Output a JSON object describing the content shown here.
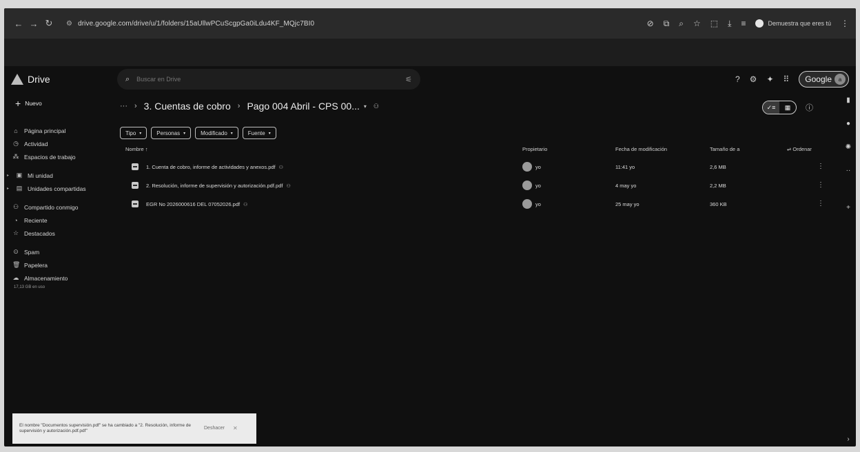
{
  "browser": {
    "back_icon": "arrow-left",
    "url": "drive.google.com/drive/u/1/folders/15aUllwPCuScgpGa0iLdu4KF_MQjc7BI0",
    "profile_label": "Demuestra que eres tú"
  },
  "header": {
    "app_name": "Drive",
    "search_placeholder": "Buscar en Drive",
    "account_pill": "Google",
    "avatar_letter": "a"
  },
  "sidebar": {
    "new_label": "Nuevo",
    "items": [
      {
        "label": "Página principal",
        "icon": "home-icon"
      },
      {
        "label": "Actividad",
        "icon": "activity-icon"
      },
      {
        "label": "Espacios de trabajo",
        "icon": "workspace-icon"
      },
      {
        "label": "Mi unidad",
        "icon": "my-drive-icon"
      },
      {
        "label": "Unidades compartidas",
        "icon": "shared-drives-icon"
      },
      {
        "label": "Compartido conmigo",
        "icon": "shared-with-me-icon"
      },
      {
        "label": "Reciente",
        "icon": "recent-icon"
      },
      {
        "label": "Destacados",
        "icon": "star-icon"
      },
      {
        "label": "Spam",
        "icon": "spam-icon"
      },
      {
        "label": "Papelera",
        "icon": "trash-icon"
      },
      {
        "label": "Almacenamiento",
        "icon": "cloud-icon"
      }
    ],
    "storage_text": "17,13 GB en uso"
  },
  "main": {
    "breadcrumb_root": "3. Cuentas de cobro",
    "breadcrumb_current": "Pago 004 Abril - CPS 00...",
    "filters": [
      "Tipo",
      "Personas",
      "Modificado",
      "Fuente"
    ],
    "columns": {
      "name": "Nombre",
      "owner": "Propietario",
      "modified": "Fecha de modificación",
      "size": "Tamaño de a",
      "sort": "Ordenar"
    },
    "files": [
      {
        "name": "1. Cuenta de cobro, informe de actividades y anexos.pdf",
        "owner": "yo",
        "modified": "11:41 yo",
        "size": "2,6 MB"
      },
      {
        "name": "2. Resolución, informe de supervisión y autorización.pdf.pdf",
        "owner": "yo",
        "modified": "4 may yo",
        "size": "2,2 MB"
      },
      {
        "name": "EGR No 2026000616 DEL 07052026.pdf",
        "owner": "yo",
        "modified": "25 may yo",
        "size": "360 KB"
      }
    ]
  },
  "toast": {
    "message": "El nombre \"Documentos supervisión.pdf\" se ha cambiado a \"2. Resolución, informe de supervisión y autorización.pdf.pdf\"",
    "undo_label": "Deshacer",
    "close_label": "✕"
  }
}
